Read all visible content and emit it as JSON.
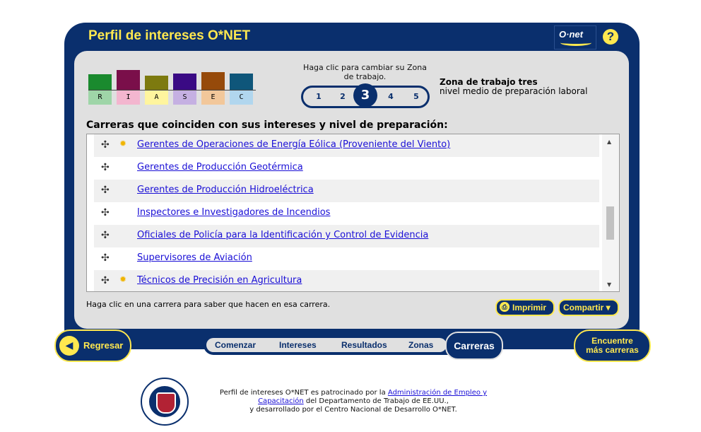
{
  "header": {
    "title": "Perfil de intereses O*NET",
    "logo_text": "O·net",
    "help": "?"
  },
  "riasec": [
    {
      "letter": "R",
      "color": "#1a8a2e",
      "light": "#9fd5a8",
      "level": 0.75
    },
    {
      "letter": "I",
      "color": "#7a0f4a",
      "light": "#f3b6cf",
      "level": 0.95
    },
    {
      "letter": "A",
      "color": "#7d7a0f",
      "light": "#fff59e",
      "level": 0.7
    },
    {
      "letter": "S",
      "color": "#3a0a84",
      "light": "#c5b0e2",
      "level": 0.8
    },
    {
      "letter": "E",
      "color": "#964a0a",
      "light": "#f2c79a",
      "level": 0.85
    },
    {
      "letter": "C",
      "color": "#0f567a",
      "light": "#b1d6ee",
      "level": 0.8
    }
  ],
  "zone": {
    "hint": "Haga clic para cambiar su Zona de trabajo.",
    "options": [
      "1",
      "2",
      "3",
      "4",
      "5"
    ],
    "selected": "3",
    "title": "Zona de trabajo tres",
    "description": "nivel medio de preparación laboral"
  },
  "list": {
    "heading": "Carreras que coinciden con sus intereses y nivel de preparación:",
    "items": [
      {
        "label": "Gerentes de Operaciones de Energía Eólica (Proveniente del Viento)",
        "bright": true
      },
      {
        "label": "Gerentes de Producción Geotérmica",
        "bright": false
      },
      {
        "label": "Gerentes de Producción Hidroeléctrica",
        "bright": false
      },
      {
        "label": "Inspectores e Investigadores de Incendios",
        "bright": false
      },
      {
        "label": "Oficiales de Policía para la Identificación y Control de Evidencia",
        "bright": false
      },
      {
        "label": "Supervisores de Aviación",
        "bright": false
      },
      {
        "label": "Técnicos de Precisión en Agricultura",
        "bright": true
      }
    ],
    "click_hint": "Haga clic en una carrera para saber que hacen en esa carrera."
  },
  "actions": {
    "print_label": "Imprimir",
    "share_label": "Compartir ▾"
  },
  "nav": {
    "back_label": "Regresar",
    "items": [
      "Comenzar",
      "Intereses",
      "Resultados",
      "Zonas"
    ],
    "current": "Carreras",
    "more_line1": "Encuentre",
    "more_line2": "más carreras"
  },
  "footer": {
    "text1": "Perfil de intereses O*NET es patrocinado por la ",
    "link": "Administración de Empleo y Capacitación",
    "text2": " del Departamento de Trabajo de EE.UU.,",
    "text3": "y desarrollado por el Centro Nacional de Desarrollo O*NET."
  }
}
